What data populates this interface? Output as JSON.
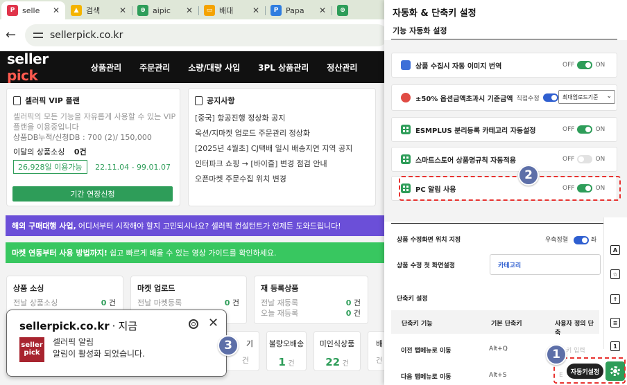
{
  "browser": {
    "tabs": [
      {
        "label": "selle",
        "fav_color": "#e0344a",
        "fav_glyph": "P",
        "active": true
      },
      {
        "label": "검색",
        "fav_color": "#f4b400",
        "fav_glyph": "▲"
      },
      {
        "label": "aipic",
        "fav_color": "#2e9d59",
        "fav_glyph": "⊕"
      },
      {
        "label": "배대",
        "fav_color": "#f4a300",
        "fav_glyph": "▭"
      },
      {
        "label": "Papa",
        "fav_color": "#2f7de0",
        "fav_glyph": "P"
      },
      {
        "label": "",
        "fav_color": "#2e9d59",
        "fav_glyph": "⊕"
      }
    ],
    "url": "sellerpick.co.kr"
  },
  "site": {
    "logo_a": "seller",
    "logo_b": "pick",
    "nav": [
      "상품관리",
      "주문관리",
      "소량/대량 사입",
      "3PL 상품관리",
      "정산관리"
    ]
  },
  "vip": {
    "title": "셀러픽 VIP 플랜",
    "desc1": "셀러픽의 모든 기능을 자유롭게 사용할 수 있는 VIP",
    "desc2": "플랜을 이용중입니다",
    "db": "상품DB누적/신청DB : 700 (2)/ 150,000",
    "monthly_label": "이달의 상품소싱",
    "monthly_value": "0건",
    "days_badge": "26,928일 이용가능",
    "period": "22.11.04 - 99.01.07",
    "button": "기간 연장신청"
  },
  "notice": {
    "title": "공지사항",
    "items": [
      "[중국] 항공진행 정상화 공지",
      "옥션/지마켓 업로드 주문관리 정상화",
      "[2025년 4월초] CJ택배 일시 배송지연 지역 공지",
      "인터파크 쇼핑 → [바이즐] 변경 점검 안내",
      "오픈마켓 주문수집 위치 변경"
    ]
  },
  "banners": {
    "purple_bold": "해외 구매대행 사업,",
    "purple_rest": "어디서부터 시작해야 할지 고민되시나요? 셀러픽 컨설턴트가 언제든 도와드립니다!",
    "green_bold": "마켓 연동부터 사용 방법까지!",
    "green_rest": "쉽고 빠르게 배울 수 있는 영상 가이드를 확인하세요.",
    "purple_color": "#6b4fd8",
    "green_color": "#38c760"
  },
  "stats": {
    "sourcing": {
      "title": "상품 소싱",
      "row1": "전날 상품소싱",
      "val": "0",
      "unit": "건"
    },
    "upload": {
      "title": "마켓 업로드",
      "row1": "전날 마켓등록",
      "val": "0",
      "unit": "건"
    },
    "reg": {
      "title": "재 등록상품",
      "row1": "전날 재등록",
      "row2": "오늘 재등록",
      "val1": "0",
      "val2": "0",
      "unit": "건"
    },
    "small": [
      {
        "label": "기",
        "val": "0",
        "unit": "건"
      },
      {
        "label": "불량오배송",
        "val": "1",
        "unit": "건"
      },
      {
        "label": "미인식상품",
        "val": "22",
        "unit": "건"
      },
      {
        "label": "배",
        "val": "",
        "unit": "건"
      }
    ]
  },
  "popup": {
    "site": "sellerpick.co.kr",
    "dot": "·",
    "time": "지금",
    "logo_a": "seller",
    "logo_b": "pick",
    "line1": "셀러픽 알림",
    "line2": "알림이 활성화 되었습니다."
  },
  "panel": {
    "title": "자동화 & 단축키 설정",
    "subtitle": "기능 자동화 설정",
    "features": [
      {
        "label": "상품 수집시 자동 이미지 번역",
        "state": "on"
      },
      {
        "label": "±50% 옵션금액초과시 기준금액",
        "extra": "직접수정",
        "select": "최대업로드기준",
        "state": "blue"
      },
      {
        "label": "ESMPLUS 분리등록 카테고리 자동설정",
        "state": "on"
      },
      {
        "label": "스마트스토어 상품명규칙 자동적용",
        "state": "off"
      },
      {
        "label": "PC 알림 사용",
        "state": "on"
      }
    ],
    "off": "OFF",
    "on": "ON",
    "pos_label": "상품 수정화면 위치 지정",
    "pos_right": "우측정렬",
    "pos_cut": "좌",
    "first_label": "상품 수정 첫 화면설정",
    "first_value": "카테고리",
    "shortcut_title": "단축키 설정",
    "col_fn": "단축키 기능",
    "col_default": "기본 단축키",
    "col_custom": "사용자 정의 단축",
    "rows": [
      {
        "fn": "이전 탭메뉴로 이동",
        "key": "Alt+Q",
        "ph": "키 입력"
      },
      {
        "fn": "다음 탭메뉴로 이동",
        "key": "Alt+S",
        "ph": "E"
      }
    ],
    "auto_button": "자동키설정"
  },
  "annotations": [
    "1",
    "2",
    "3"
  ]
}
